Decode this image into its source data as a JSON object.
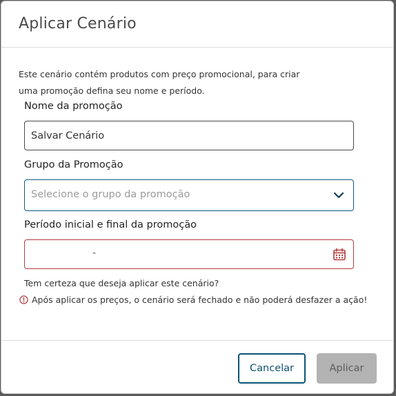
{
  "dialog": {
    "title": "Aplicar Cenário",
    "description": "Este cenário contém produtos com preço promocional, para criar uma promoção defina seu nome e período."
  },
  "form": {
    "name_label": "Nome da promoção",
    "name_value": "Salvar Cenário",
    "group_label": "Grupo da Promoção",
    "group_placeholder": "Selecione o grupo da promoção",
    "period_label": "Período inicial e final da promoção",
    "period_separator": "-"
  },
  "confirmation": {
    "question": "Tem certeza que deseja aplicar este cenário?",
    "warning": "Após aplicar os preços, o cenário será fechado e não poderá desfazer a ação!"
  },
  "footer": {
    "cancel_label": "Cancelar",
    "apply_label": "Aplicar"
  },
  "icons": {
    "dropdown": "chevron-down-icon",
    "calendar": "calendar-icon",
    "warning": "exclamation-circle-icon"
  },
  "colors": {
    "primary": "#0e5375",
    "error": "#b73a3a",
    "disabled": "#b3b3b3"
  }
}
